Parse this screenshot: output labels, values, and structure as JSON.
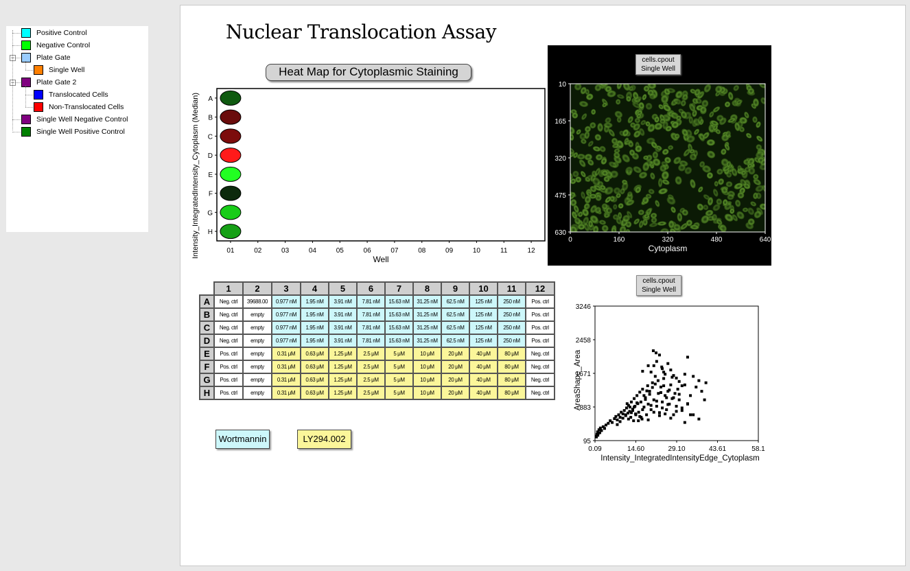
{
  "tree": {
    "nodes": [
      {
        "label": "Positive Control",
        "color": "#00ffff",
        "name": "tree-node-positive-control"
      },
      {
        "label": "Negative Control",
        "color": "#00ff00",
        "name": "tree-node-negative-control"
      },
      {
        "label": "Plate Gate",
        "color": "#99ccff",
        "name": "tree-node-plate-gate"
      },
      {
        "label": "Single Well",
        "color": "#ff8000",
        "name": "tree-node-single-well"
      },
      {
        "label": "Plate Gate 2",
        "color": "#800080",
        "name": "tree-node-plate-gate-2"
      },
      {
        "label": "Translocated Cells",
        "color": "#0000ff",
        "name": "tree-node-translocated-cells"
      },
      {
        "label": "Non-Translocated Cells",
        "color": "#ff0000",
        "name": "tree-node-non-translocated-cells"
      },
      {
        "label": "Single Well Negative Control",
        "color": "#800080",
        "name": "tree-node-single-well-negative-control"
      },
      {
        "label": "Single Well Positive Control",
        "color": "#008000",
        "name": "tree-node-single-well-positive-control"
      }
    ]
  },
  "page": {
    "title": "Nuclear Translocation Assay"
  },
  "heatmap": {
    "title": "Heat Map for Cytoplasmic Staining",
    "xlabel": "Well",
    "ylabel": "Intensity_IntegratedIntensity_Cytoplasm (Median)",
    "rows": [
      "A",
      "B",
      "C",
      "D",
      "E",
      "F",
      "G",
      "H"
    ],
    "cols": [
      "01",
      "02",
      "03",
      "04",
      "05",
      "06",
      "07",
      "08",
      "09",
      "10",
      "11",
      "12"
    ],
    "cells": [
      {
        "row": "A",
        "col": "01",
        "color": "#0f5a10"
      },
      {
        "row": "B",
        "col": "01",
        "color": "#6a0c0c"
      },
      {
        "row": "C",
        "col": "01",
        "color": "#7c0c0c"
      },
      {
        "row": "D",
        "col": "01",
        "color": "#ff1a1a"
      },
      {
        "row": "E",
        "col": "01",
        "color": "#22ff22"
      },
      {
        "row": "F",
        "col": "01",
        "color": "#0d2a0d"
      },
      {
        "row": "G",
        "col": "01",
        "color": "#18cc18"
      },
      {
        "row": "H",
        "col": "01",
        "color": "#16a016"
      }
    ]
  },
  "image_panel": {
    "tag_line1": "cells.cpout",
    "tag_line2": "Single Well",
    "xlabel": "Cytoplasm",
    "xticks": [
      "0",
      "160",
      "320",
      "480",
      "640"
    ],
    "yticks": [
      "10",
      "165",
      "320",
      "475",
      "630"
    ]
  },
  "plate": {
    "col_headers": [
      "1",
      "2",
      "3",
      "4",
      "5",
      "6",
      "7",
      "8",
      "9",
      "10",
      "11",
      "12"
    ],
    "rows": [
      {
        "label": "A",
        "cells": [
          "Neg. ctrl",
          "39688.00",
          "0.977 nM",
          "1.95 nM",
          "3.91 nM",
          "7.81 nM",
          "15.63 nM",
          "31.25 nM",
          "62.5 nM",
          "125 nM",
          "250 nM",
          "Pos. ctrl"
        ]
      },
      {
        "label": "B",
        "cells": [
          "Neg. ctrl",
          "empty",
          "0.977 nM",
          "1.95 nM",
          "3.91 nM",
          "7.81 nM",
          "15.63 nM",
          "31.25 nM",
          "62.5 nM",
          "125 nM",
          "250 nM",
          "Pos. ctrl"
        ]
      },
      {
        "label": "C",
        "cells": [
          "Neg. ctrl",
          "empty",
          "0.977 nM",
          "1.95 nM",
          "3.91 nM",
          "7.81 nM",
          "15.63 nM",
          "31.25 nM",
          "62.5 nM",
          "125 nM",
          "250 nM",
          "Pos. ctrl"
        ]
      },
      {
        "label": "D",
        "cells": [
          "Neg. ctrl",
          "empty",
          "0.977 nM",
          "1.95 nM",
          "3.91 nM",
          "7.81 nM",
          "15.63 nM",
          "31.25 nM",
          "62.5 nM",
          "125 nM",
          "250 nM",
          "Pos. ctrl"
        ]
      },
      {
        "label": "E",
        "cells": [
          "Pos. ctrl",
          "empty",
          "0.31 μM",
          "0.63 μM",
          "1.25 μM",
          "2.5 μM",
          "5 μM",
          "10 μM",
          "20 μM",
          "40 μM",
          "80 μM",
          "Neg. ctrl"
        ]
      },
      {
        "label": "F",
        "cells": [
          "Pos. ctrl",
          "empty",
          "0.31 μM",
          "0.63 μM",
          "1.25 μM",
          "2.5 μM",
          "5 μM",
          "10 μM",
          "20 μM",
          "40 μM",
          "80 μM",
          "Neg. ctrl"
        ]
      },
      {
        "label": "G",
        "cells": [
          "Pos. ctrl",
          "empty",
          "0.31 μM",
          "0.63 μM",
          "1.25 μM",
          "2.5 μM",
          "5 μM",
          "10 μM",
          "20 μM",
          "40 μM",
          "80 μM",
          "Neg. ctrl"
        ]
      },
      {
        "label": "H",
        "cells": [
          "Pos. ctrl",
          "empty",
          "0.31 μM",
          "0.63 μM",
          "1.25 μM",
          "2.5 μM",
          "5 μM",
          "10 μM",
          "20 μM",
          "40 μM",
          "80 μM",
          "Neg. ctrl"
        ]
      }
    ],
    "legend": [
      {
        "label": "Wortmannin",
        "color": "#cdf7fa"
      },
      {
        "label": "LY294.002",
        "color": "#fbf69a"
      }
    ]
  },
  "scatter": {
    "tag_line1": "cells.cpout",
    "tag_line2": "Single Well",
    "xlabel": "Intensity_IntegratedIntensityEdge_Cytoplasm",
    "ylabel": "AreaShape_Area",
    "xticks": [
      "0.09",
      "14.60",
      "29.10",
      "43.61",
      "58.1"
    ],
    "yticks": [
      "3246",
      "2458",
      "1671",
      "883",
      "95"
    ]
  },
  "chart_data": {
    "type": "scatter",
    "xlabel": "Intensity_IntegratedIntensityEdge_Cytoplasm",
    "ylabel": "AreaShape_Area",
    "xlim": [
      0.09,
      58.12
    ],
    "ylim": [
      95,
      3246
    ],
    "grid": false,
    "x": [
      0.5,
      0.8,
      1.0,
      1.2,
      1.5,
      1.8,
      2.0,
      2.4,
      0.6,
      1.1,
      3.0,
      3.5,
      4.0,
      4.8,
      5.5,
      6.2,
      7.0,
      7.5,
      8.0,
      8.5,
      9.0,
      9.4,
      10.0,
      10.5,
      11.0,
      11.3,
      11.8,
      12.0,
      12.4,
      12.8,
      13.0,
      13.5,
      13.8,
      14.0,
      14.3,
      14.6,
      15.0,
      15.3,
      15.6,
      16.0,
      16.4,
      16.8,
      17.0,
      17.5,
      18.0,
      18.4,
      18.8,
      19.0,
      19.5,
      20.0,
      20.5,
      21.0,
      21.5,
      22.0,
      22.6,
      23.0,
      23.5,
      24.0,
      24.5,
      25.0,
      25.5,
      26.0,
      26.5,
      27.0,
      27.5,
      28.0,
      28.5,
      29.0,
      29.5,
      30.0,
      31.0,
      32.0,
      33.0,
      34.0,
      35.0,
      36.0,
      37.0,
      38.0,
      39.0,
      12.0,
      13.0,
      14.0,
      15.0,
      16.0,
      17.0,
      18.0,
      19.0,
      20.0,
      21.0,
      22.0,
      23.0,
      24.0,
      25.0,
      26.0,
      27.0,
      28.0,
      29.0,
      30.0,
      31.0,
      32.0,
      33.0,
      34.0,
      9.0,
      10.0,
      11.0,
      8.0,
      17.5,
      18.5,
      19.5,
      20.5,
      21.5,
      22.5,
      23.5,
      24.5,
      25.5,
      26.5,
      15.5,
      16.5,
      14.5,
      13.5,
      12.5,
      11.5,
      20.0,
      21.0,
      22.0,
      23.0,
      24.0,
      25.0,
      26.0,
      27.0,
      28.0,
      29.0,
      30.0,
      31.0,
      32.0,
      20.8,
      21.8,
      23.8,
      33.0,
      35.0,
      37.0,
      39.5,
      27.5,
      24.5,
      19.0,
      17.0
    ],
    "y": [
      200,
      240,
      300,
      260,
      350,
      280,
      390,
      330,
      180,
      220,
      420,
      380,
      460,
      500,
      560,
      520,
      610,
      660,
      580,
      700,
      640,
      760,
      720,
      800,
      680,
      860,
      740,
      920,
      780,
      640,
      1000,
      830,
      560,
      1080,
      900,
      700,
      1150,
      960,
      760,
      1230,
      1000,
      600,
      1300,
      880,
      1100,
      700,
      1380,
      950,
      1250,
      820,
      1450,
      1050,
      1600,
      900,
      1200,
      750,
      1350,
      1000,
      1550,
      1150,
      820,
      1250,
      950,
      1400,
      1080,
      700,
      1200,
      900,
      1300,
      1050,
      800,
      1400,
      950,
      1150,
      700,
      1350,
      600,
      1250,
      1050,
      600,
      750,
      880,
      980,
      660,
      820,
      1060,
      580,
      920,
      760,
      1020,
      680,
      860,
      720,
      940,
      620,
      1100,
      780,
      1180,
      860,
      520,
      960,
      700,
      540,
      620,
      700,
      470,
      1150,
      1260,
      1180,
      1340,
      1420,
      1500,
      1220,
      1380,
      1100,
      1280,
      560,
      640,
      720,
      800,
      880,
      960,
      1700,
      1850,
      1950,
      2100,
      1780,
      1650,
      1900,
      1750,
      1620,
      1560,
      1480,
      1380,
      1650,
      2200,
      2150,
      1820,
      2050,
      1600,
      1500,
      1450,
      1580,
      1700,
      1850,
      1720
    ]
  }
}
